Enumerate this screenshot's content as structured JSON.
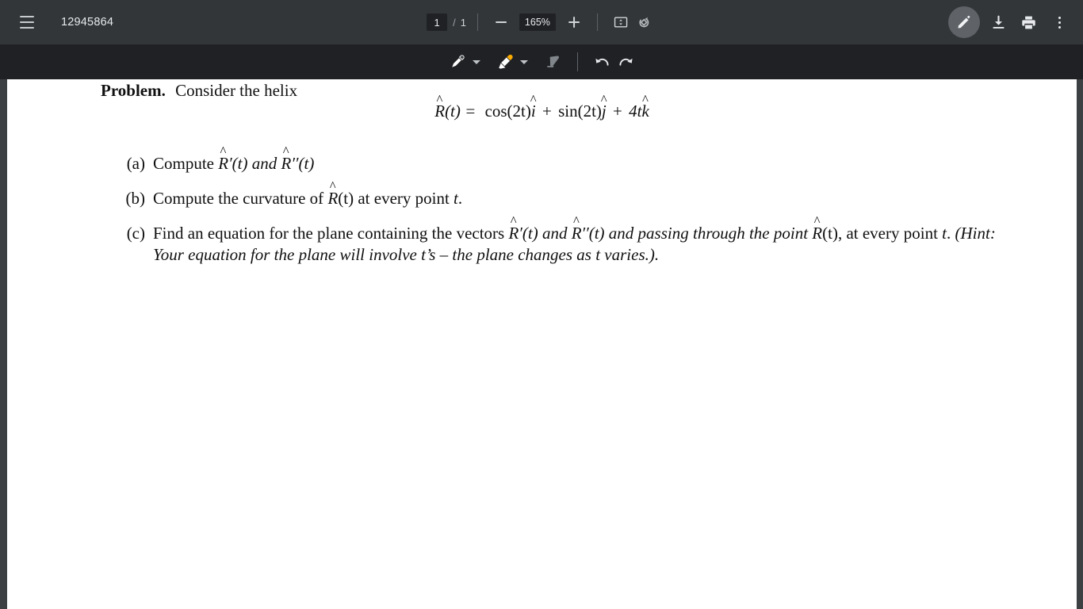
{
  "window": {
    "background_color": "#3c4043",
    "toolbar_color": "#323639",
    "annotation_bar_color": "#202124",
    "accent_color": "#f9ab00"
  },
  "toolbar": {
    "menu_icon": "hamburger-menu-icon",
    "document_title": "12945864",
    "page_current": "1",
    "page_separator": "/",
    "page_total": "1",
    "zoom_out_label": "−",
    "zoom_level": "165%",
    "zoom_in_label": "+",
    "fit_page_icon": "fit-to-page-icon",
    "rotate_icon": "rotate-icon",
    "annotate_icon": "pencil-icon",
    "download_icon": "download-icon",
    "print_icon": "print-icon",
    "more_icon": "more-vertical-icon"
  },
  "annotation_toolbar": {
    "pen_icon": "pen-icon",
    "pen_dropdown_icon": "chevron-down-icon",
    "highlighter_icon": "highlighter-icon",
    "highlighter_dropdown_icon": "chevron-down-icon",
    "eraser_icon": "eraser-icon",
    "undo_icon": "undo-icon",
    "redo_icon": "redo-icon"
  },
  "document": {
    "problem_label": "Problem.",
    "problem_intro": "Consider the helix",
    "equation": {
      "lhs_var": "R",
      "lhs_arg": "(t) =",
      "term1_fn": "cos(2t)",
      "term1_unit": "i",
      "plus1": "+",
      "term2_fn": "sin(2t)",
      "term2_unit": "j",
      "plus2": "+",
      "term3_coef": "4t",
      "term3_unit": "k"
    },
    "items": [
      {
        "label": "(a)",
        "text_parts": {
          "p1": "Compute ",
          "v1": "R",
          "p2": "′(t) and ",
          "v2": "R",
          "p3": "′′(t)"
        }
      },
      {
        "label": "(b)",
        "text_parts": {
          "p1": "Compute the curvature of ",
          "v1": "R",
          "p2": "(t) at every point ",
          "v2": "t",
          "p3": "."
        }
      },
      {
        "label": "(c)",
        "text_parts": {
          "p1": "Find an equation for the plane containing the vectors ",
          "v1": "R",
          "p2": "′(t) and ",
          "v2": "R",
          "p3": "′′(t) and passing through the point ",
          "v3": "R",
          "p4": "(t), at every point ",
          "v4": "t",
          "p5": ". ",
          "hint": "(Hint: Your equation for the plane will involve t’s – the plane changes as t varies.)."
        }
      }
    ]
  }
}
